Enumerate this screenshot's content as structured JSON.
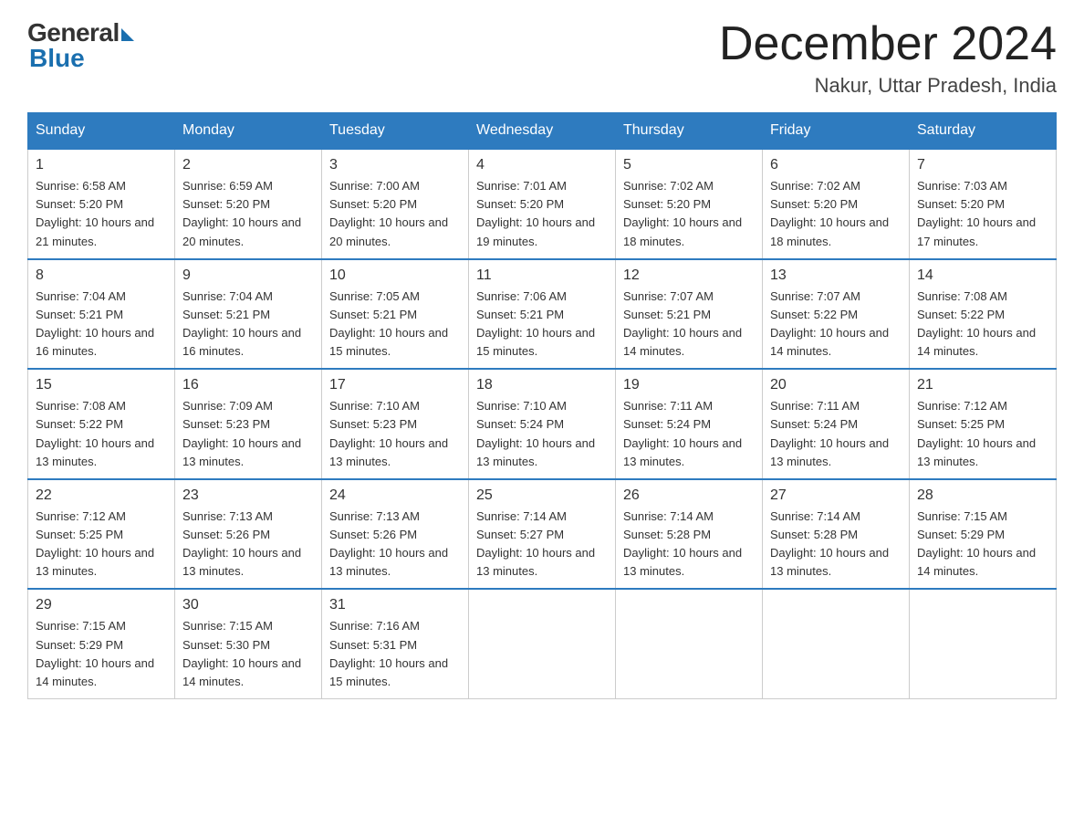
{
  "logo": {
    "general": "General",
    "blue": "Blue"
  },
  "header": {
    "month_year": "December 2024",
    "location": "Nakur, Uttar Pradesh, India"
  },
  "weekdays": [
    "Sunday",
    "Monday",
    "Tuesday",
    "Wednesday",
    "Thursday",
    "Friday",
    "Saturday"
  ],
  "weeks": [
    [
      {
        "day": "1",
        "sunrise": "6:58 AM",
        "sunset": "5:20 PM",
        "daylight": "10 hours and 21 minutes."
      },
      {
        "day": "2",
        "sunrise": "6:59 AM",
        "sunset": "5:20 PM",
        "daylight": "10 hours and 20 minutes."
      },
      {
        "day": "3",
        "sunrise": "7:00 AM",
        "sunset": "5:20 PM",
        "daylight": "10 hours and 20 minutes."
      },
      {
        "day": "4",
        "sunrise": "7:01 AM",
        "sunset": "5:20 PM",
        "daylight": "10 hours and 19 minutes."
      },
      {
        "day": "5",
        "sunrise": "7:02 AM",
        "sunset": "5:20 PM",
        "daylight": "10 hours and 18 minutes."
      },
      {
        "day": "6",
        "sunrise": "7:02 AM",
        "sunset": "5:20 PM",
        "daylight": "10 hours and 18 minutes."
      },
      {
        "day": "7",
        "sunrise": "7:03 AM",
        "sunset": "5:20 PM",
        "daylight": "10 hours and 17 minutes."
      }
    ],
    [
      {
        "day": "8",
        "sunrise": "7:04 AM",
        "sunset": "5:21 PM",
        "daylight": "10 hours and 16 minutes."
      },
      {
        "day": "9",
        "sunrise": "7:04 AM",
        "sunset": "5:21 PM",
        "daylight": "10 hours and 16 minutes."
      },
      {
        "day": "10",
        "sunrise": "7:05 AM",
        "sunset": "5:21 PM",
        "daylight": "10 hours and 15 minutes."
      },
      {
        "day": "11",
        "sunrise": "7:06 AM",
        "sunset": "5:21 PM",
        "daylight": "10 hours and 15 minutes."
      },
      {
        "day": "12",
        "sunrise": "7:07 AM",
        "sunset": "5:21 PM",
        "daylight": "10 hours and 14 minutes."
      },
      {
        "day": "13",
        "sunrise": "7:07 AM",
        "sunset": "5:22 PM",
        "daylight": "10 hours and 14 minutes."
      },
      {
        "day": "14",
        "sunrise": "7:08 AM",
        "sunset": "5:22 PM",
        "daylight": "10 hours and 14 minutes."
      }
    ],
    [
      {
        "day": "15",
        "sunrise": "7:08 AM",
        "sunset": "5:22 PM",
        "daylight": "10 hours and 13 minutes."
      },
      {
        "day": "16",
        "sunrise": "7:09 AM",
        "sunset": "5:23 PM",
        "daylight": "10 hours and 13 minutes."
      },
      {
        "day": "17",
        "sunrise": "7:10 AM",
        "sunset": "5:23 PM",
        "daylight": "10 hours and 13 minutes."
      },
      {
        "day": "18",
        "sunrise": "7:10 AM",
        "sunset": "5:24 PM",
        "daylight": "10 hours and 13 minutes."
      },
      {
        "day": "19",
        "sunrise": "7:11 AM",
        "sunset": "5:24 PM",
        "daylight": "10 hours and 13 minutes."
      },
      {
        "day": "20",
        "sunrise": "7:11 AM",
        "sunset": "5:24 PM",
        "daylight": "10 hours and 13 minutes."
      },
      {
        "day": "21",
        "sunrise": "7:12 AM",
        "sunset": "5:25 PM",
        "daylight": "10 hours and 13 minutes."
      }
    ],
    [
      {
        "day": "22",
        "sunrise": "7:12 AM",
        "sunset": "5:25 PM",
        "daylight": "10 hours and 13 minutes."
      },
      {
        "day": "23",
        "sunrise": "7:13 AM",
        "sunset": "5:26 PM",
        "daylight": "10 hours and 13 minutes."
      },
      {
        "day": "24",
        "sunrise": "7:13 AM",
        "sunset": "5:26 PM",
        "daylight": "10 hours and 13 minutes."
      },
      {
        "day": "25",
        "sunrise": "7:14 AM",
        "sunset": "5:27 PM",
        "daylight": "10 hours and 13 minutes."
      },
      {
        "day": "26",
        "sunrise": "7:14 AM",
        "sunset": "5:28 PM",
        "daylight": "10 hours and 13 minutes."
      },
      {
        "day": "27",
        "sunrise": "7:14 AM",
        "sunset": "5:28 PM",
        "daylight": "10 hours and 13 minutes."
      },
      {
        "day": "28",
        "sunrise": "7:15 AM",
        "sunset": "5:29 PM",
        "daylight": "10 hours and 14 minutes."
      }
    ],
    [
      {
        "day": "29",
        "sunrise": "7:15 AM",
        "sunset": "5:29 PM",
        "daylight": "10 hours and 14 minutes."
      },
      {
        "day": "30",
        "sunrise": "7:15 AM",
        "sunset": "5:30 PM",
        "daylight": "10 hours and 14 minutes."
      },
      {
        "day": "31",
        "sunrise": "7:16 AM",
        "sunset": "5:31 PM",
        "daylight": "10 hours and 15 minutes."
      },
      null,
      null,
      null,
      null
    ]
  ]
}
